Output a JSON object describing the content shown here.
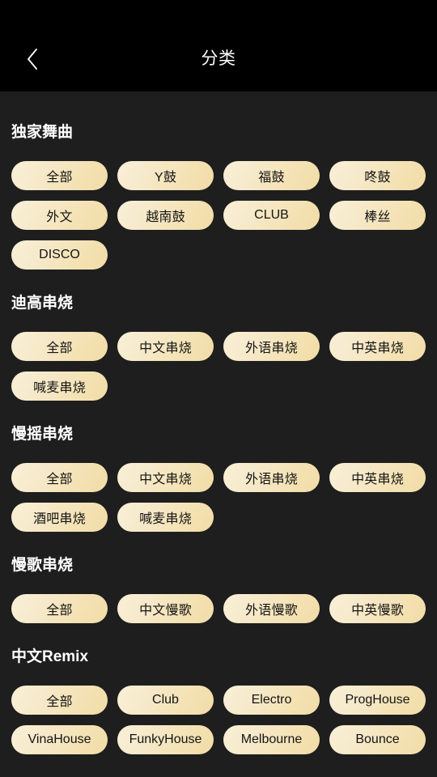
{
  "header": {
    "title": "分类",
    "back_icon": "chevron-left-icon"
  },
  "sections": [
    {
      "title": "独家舞曲",
      "chips": [
        "全部",
        "Y鼓",
        "福鼓",
        "咚鼓",
        "外文",
        "越南鼓",
        "CLUB",
        "棒丝",
        "DISCO"
      ]
    },
    {
      "title": "迪高串烧",
      "chips": [
        "全部",
        "中文串烧",
        "外语串烧",
        "中英串烧",
        "喊麦串烧"
      ]
    },
    {
      "title": "慢摇串烧",
      "chips": [
        "全部",
        "中文串烧",
        "外语串烧",
        "中英串烧",
        "酒吧串烧",
        "喊麦串烧"
      ]
    },
    {
      "title": "慢歌串烧",
      "chips": [
        "全部",
        "中文慢歌",
        "外语慢歌",
        "中英慢歌"
      ]
    },
    {
      "title": "中文Remix",
      "chips": [
        "全部",
        "Club",
        "Electro",
        "ProgHouse",
        "VinaHouse",
        "FunkyHouse",
        "Melbourne",
        "Bounce"
      ]
    }
  ],
  "colors": {
    "app_background": "#1e1e1e",
    "header_background": "#000000",
    "chip_gradient_start": "#f9f0d8",
    "chip_gradient_end": "#f1dca6",
    "chip_text": "#141414",
    "title_text": "#ffffff"
  }
}
